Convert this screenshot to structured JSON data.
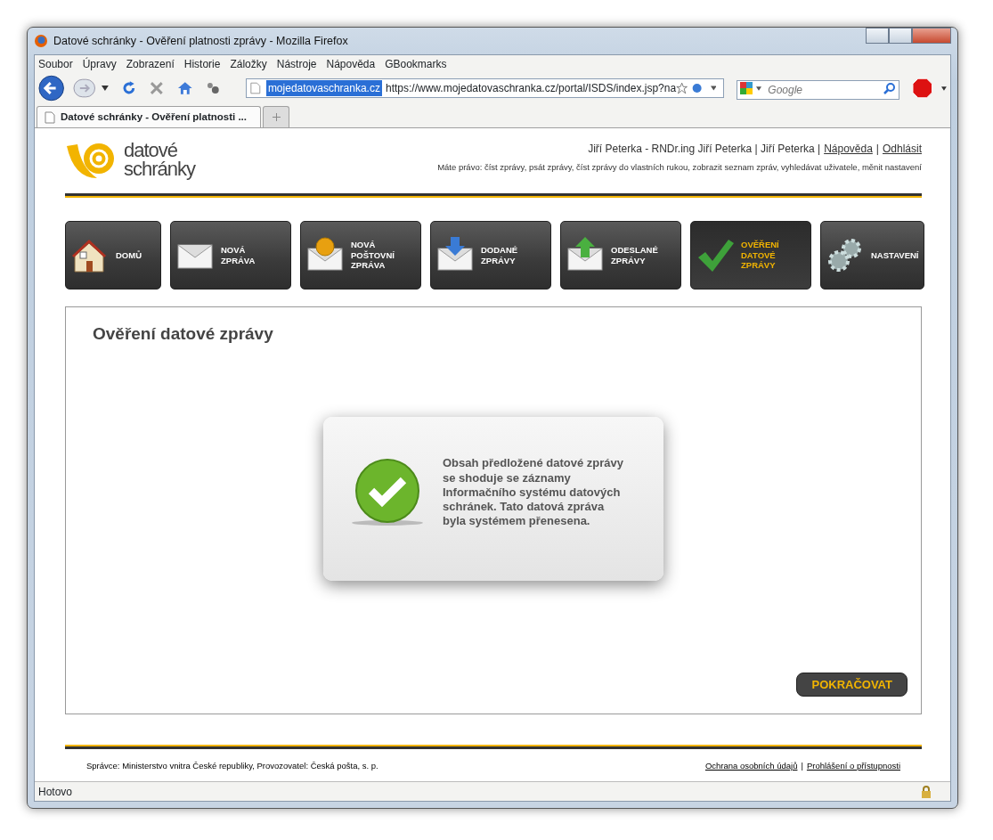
{
  "window": {
    "title": "Datové schránky - Ověření platnosti zprávy - Mozilla Firefox"
  },
  "menu": [
    "Soubor",
    "Úpravy",
    "Zobrazení",
    "Historie",
    "Záložky",
    "Nástroje",
    "Nápověda",
    "GBookmarks"
  ],
  "address_bar": {
    "site_identity": "mojedatovaschranka.cz",
    "url": "https://www.mojedatovaschranka.cz/portal/ISDS/index.jsp?na"
  },
  "search": {
    "placeholder": "Google"
  },
  "tabs": [
    {
      "label": "Datové schránky - Ověření platnosti ...",
      "selected": true
    }
  ],
  "page": {
    "logo": {
      "line_1": "datové",
      "line_2": "schránky"
    },
    "user": {
      "text": "Jiří Peterka - RNDr.ing Jiří Peterka | Jiří Peterka |",
      "links": [
        "Nápověda",
        "Odhlásit"
      ],
      "separator": "|"
    },
    "rights": "Máte právo: číst zprávy, psát zprávy, číst zprávy do vlastních rukou, zobrazit seznam zpráv, vyhledávat uživatele, měnit nastavení",
    "nav": [
      {
        "kind": "house",
        "lines": [
          "DOMŮ"
        ],
        "selected": false
      },
      {
        "kind": "envelope",
        "lines": [
          "NOVÁ",
          "ZPRÁVA"
        ],
        "selected": false
      },
      {
        "kind": "envelope-dollar",
        "lines": [
          "NOVÁ",
          "POŠTOVNÍ",
          "ZPRÁVA"
        ],
        "selected": false
      },
      {
        "kind": "envelope-in",
        "lines": [
          "DODANÉ",
          "ZPRÁVY"
        ],
        "selected": false
      },
      {
        "kind": "envelope-out",
        "lines": [
          "ODESLANÉ",
          "ZPRÁVY"
        ],
        "selected": false
      },
      {
        "kind": "check",
        "lines": [
          "OVĚŘENÍ",
          "DATOVÉ",
          "ZPRÁVY"
        ],
        "selected": true
      },
      {
        "kind": "gears",
        "lines": [
          "NASTAVENÍ"
        ],
        "selected": false
      }
    ],
    "heading": "Ověření datové zprávy",
    "result": {
      "kind": "success",
      "message": "Obsah předložené datové zprávy se shoduje se záznamy Informačního systému datových schránek. Tato datová zpráva byla systémem přenesena."
    },
    "continue_button": "POKRAČOVAT",
    "footer": {
      "text": "Správce: Ministerstvo vnitra České republiky, Provozovatel: Česká pošta, s. p.",
      "links": [
        "Ochrana osobních údajů",
        "Prohlášení o přístupnosti"
      ],
      "separator": "|"
    }
  },
  "status_bar": {
    "text": "Hotovo"
  }
}
